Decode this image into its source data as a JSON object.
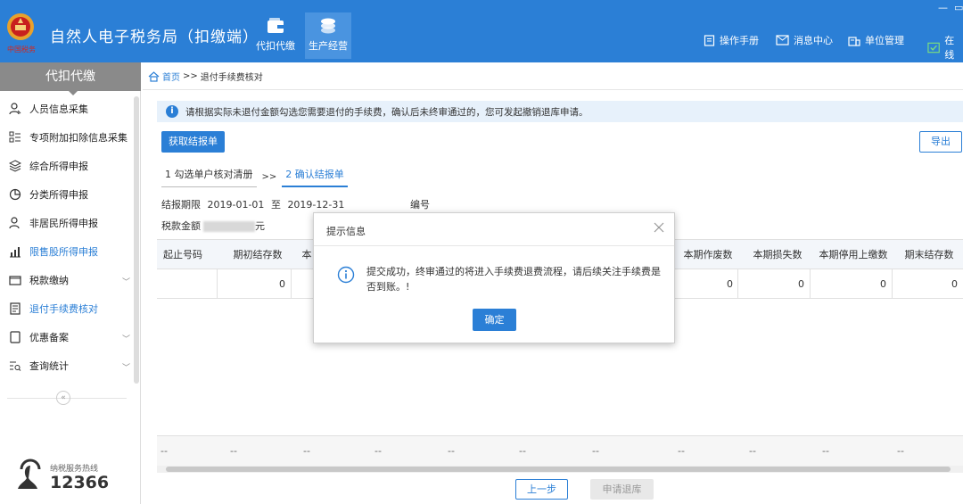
{
  "header": {
    "app_title": "自然人电子税务局（扣缴端）",
    "nav": [
      {
        "label": "代扣代缴",
        "icon": "wallet-icon"
      },
      {
        "label": "生产经营",
        "icon": "coins-icon"
      }
    ],
    "links": {
      "manual": "操作手册",
      "messages": "消息中心",
      "unit_mgmt": "单位管理",
      "online": "在线"
    },
    "window_controls": {
      "minimize": "—",
      "restore": "▭"
    }
  },
  "sidebar": {
    "title": "代扣代缴",
    "items": [
      {
        "label": "人员信息采集",
        "icon": "person-icon"
      },
      {
        "label": "专项附加扣除信息采集",
        "icon": "grid-list-icon"
      },
      {
        "label": "综合所得申报",
        "icon": "layers-icon"
      },
      {
        "label": "分类所得申报",
        "icon": "pie-icon"
      },
      {
        "label": "非居民所得申报",
        "icon": "person-alt-icon"
      },
      {
        "label": "限售股所得申报",
        "icon": "bar-chart-icon"
      },
      {
        "label": "税款缴纳",
        "icon": "folder-icon"
      },
      {
        "label": "退付手续费核对",
        "icon": "document-icon"
      },
      {
        "label": "优惠备案",
        "icon": "file-icon"
      },
      {
        "label": "查询统计",
        "icon": "search-list-icon"
      }
    ],
    "collapse_glyph": "«",
    "hotline_label": "纳税服务热线",
    "hotline_number": "12366"
  },
  "breadcrumb": {
    "home": "首页",
    "sep": ">>",
    "current": "退付手续费核对"
  },
  "notice": "请根据实际未退付金额勾选您需要退付的手续费，确认后未终审通过的，您可发起撤销退库申请。",
  "buttons": {
    "fetch": "获取结报单",
    "export": "导出",
    "prev": "上一步",
    "apply": "申请退库"
  },
  "steps": {
    "step1": "1 勾选单户核对清册",
    "arrow": ">>",
    "step2": "2 确认结报单"
  },
  "meta": {
    "period_label": "结报期限",
    "period_from": "2019-01-01",
    "to": "至",
    "period_to": "2019-12-31",
    "number_label": "编号",
    "amount_label": "税款金额",
    "amount_tail": "元"
  },
  "table": {
    "headers": [
      "起止号码",
      "期初结存数",
      "本",
      "本期作废数",
      "本期损失数",
      "本期停用上缴数",
      "期末结存数"
    ],
    "row": [
      "",
      "0",
      "",
      "0",
      "0",
      "0",
      "0"
    ],
    "footer": [
      "--",
      "--",
      "--",
      "--",
      "--",
      "--",
      "--",
      "--",
      "--",
      "--",
      "--",
      "--"
    ]
  },
  "dialog": {
    "title": "提示信息",
    "message": "提交成功，终审通过的将进入手续费退费流程，请后续关注手续费是否到账。!",
    "ok": "确定"
  },
  "colors": {
    "primary": "#2b7fd6",
    "sidebar_title": "#8a8a8a",
    "notice_bg": "#e7f1fb"
  }
}
